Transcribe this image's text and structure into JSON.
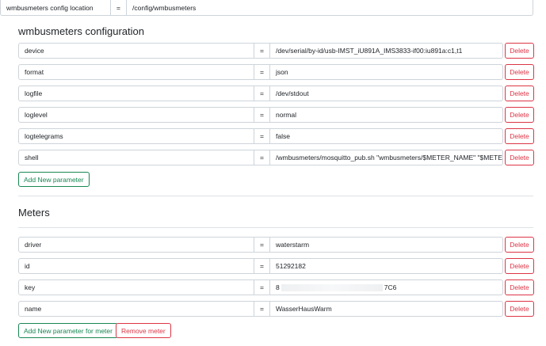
{
  "config_location": {
    "label": "wmbusmeters config location",
    "eq": "=",
    "value": "/config/wmbusmeters"
  },
  "configuration": {
    "heading": "wmbusmeters configuration",
    "params": [
      {
        "key": "device",
        "eq": "=",
        "value": "/dev/serial/by-id/usb-IMST_iU891A_IMS3833-if00:iu891a:c1,t1",
        "delete": "Delete"
      },
      {
        "key": "format",
        "eq": "=",
        "value": "json",
        "delete": "Delete"
      },
      {
        "key": "logfile",
        "eq": "=",
        "value": "/dev/stdout",
        "delete": "Delete"
      },
      {
        "key": "loglevel",
        "eq": "=",
        "value": "normal",
        "delete": "Delete"
      },
      {
        "key": "logtelegrams",
        "eq": "=",
        "value": "false",
        "delete": "Delete"
      },
      {
        "key": "shell",
        "eq": "=",
        "value": "/wmbusmeters/mosquitto_pub.sh \"wmbusmeters/$METER_NAME\" \"$METER_JSO",
        "delete": "Delete"
      }
    ],
    "add_button": "Add New parameter"
  },
  "meters": {
    "heading": "Meters",
    "params": [
      {
        "key": "driver",
        "eq": "=",
        "value": "waterstarm",
        "delete": "Delete"
      },
      {
        "key": "id",
        "eq": "=",
        "value": "51292182",
        "delete": "Delete"
      },
      {
        "key": "key",
        "eq": "=",
        "value_start": "8",
        "value_end": "7C6",
        "delete": "Delete"
      },
      {
        "key": "name",
        "eq": "=",
        "value": "WasserHausWarm",
        "delete": "Delete"
      }
    ],
    "add_button": "Add New parameter for meter",
    "remove_button": "Remove meter"
  }
}
